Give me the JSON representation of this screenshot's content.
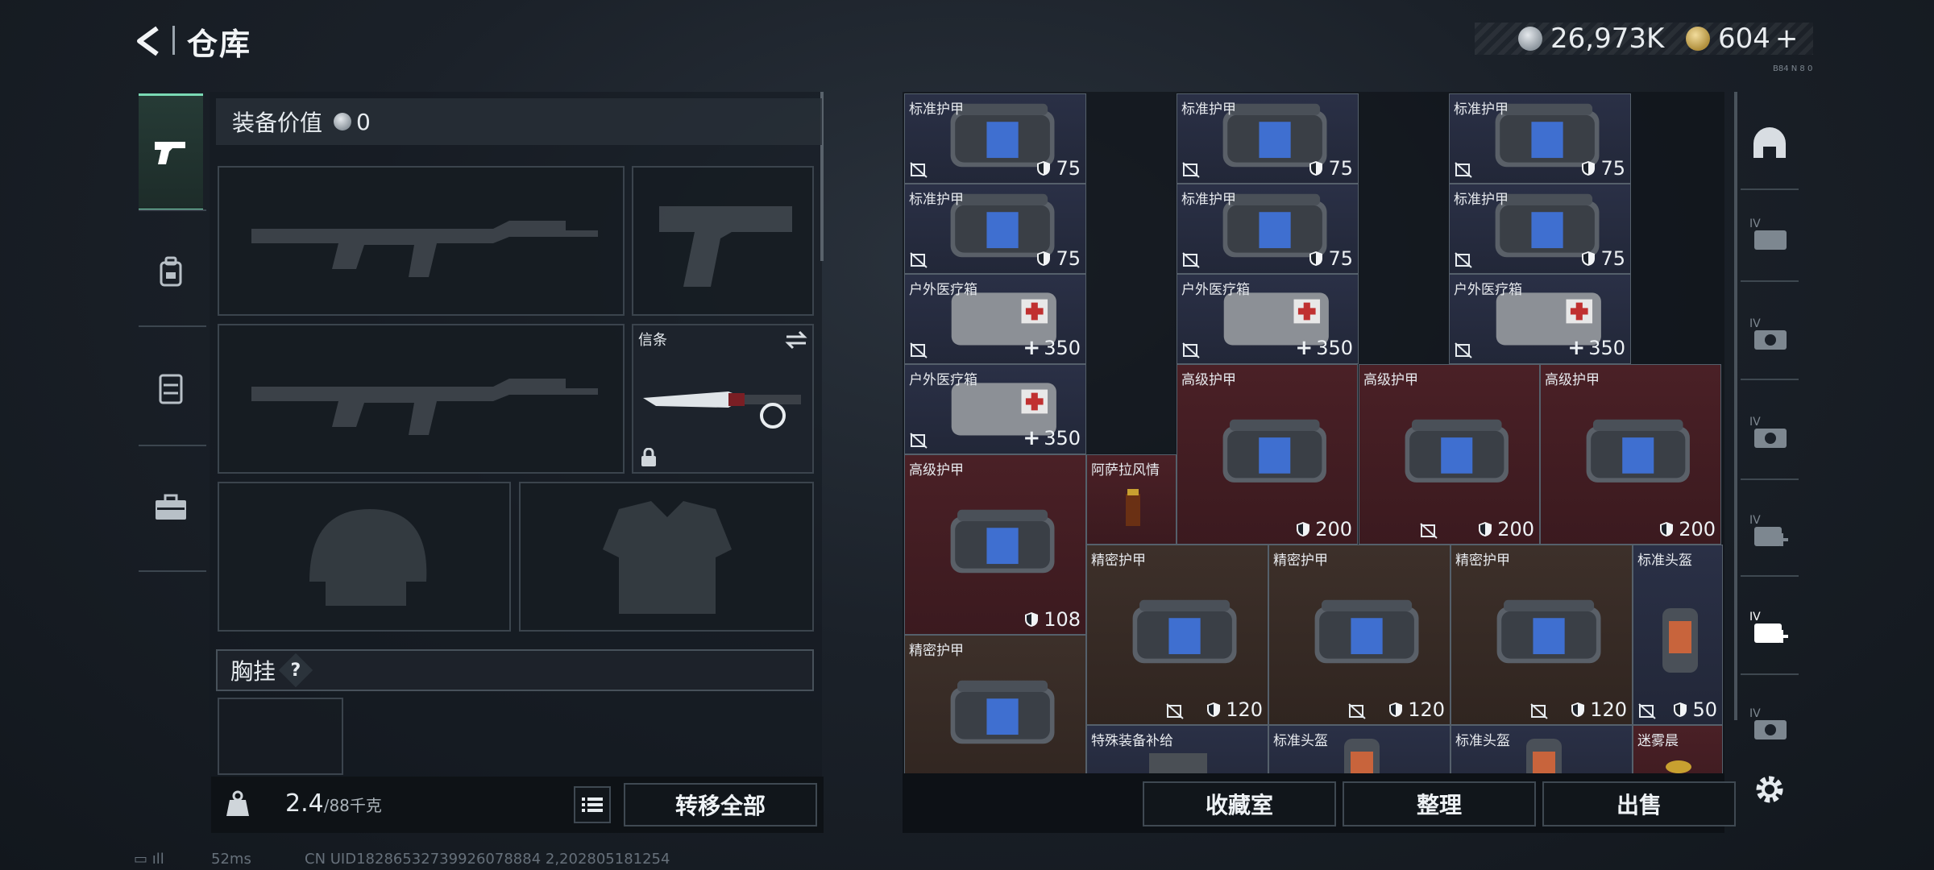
{
  "header": {
    "title": "仓库",
    "currency_silver": "26,973K",
    "currency_gold": "604",
    "plus": "+",
    "tiny_note": "B84 N 8 0"
  },
  "left_tabs": [
    "weapons",
    "backpack",
    "vest",
    "toolbox"
  ],
  "equipment": {
    "value_label": "装备价值",
    "value": "0",
    "knife_label": "信条",
    "chest_label": "胸挂",
    "chest_help": "?",
    "weight_current": "2.4",
    "weight_max": "/88千克",
    "transfer_all": "转移全部"
  },
  "grid": {
    "items": [
      {
        "name": "标准护甲",
        "value": "75",
        "type": "armor-std"
      },
      {
        "name": "标准护甲",
        "value": "75",
        "type": "armor-std"
      },
      {
        "name": "标准护甲",
        "value": "75",
        "type": "armor-std"
      },
      {
        "name": "标准护甲",
        "value": "75",
        "type": "armor-std"
      },
      {
        "name": "标准护甲",
        "value": "75",
        "type": "armor-std"
      },
      {
        "name": "标准护甲",
        "value": "75",
        "type": "armor-std"
      },
      {
        "name": "户外医疗箱",
        "value": "350",
        "type": "medkit"
      },
      {
        "name": "户外医疗箱",
        "value": "350",
        "type": "medkit"
      },
      {
        "name": "户外医疗箱",
        "value": "350",
        "type": "medkit"
      },
      {
        "name": "户外医疗箱",
        "value": "350",
        "type": "medkit"
      },
      {
        "name": "高级护甲",
        "value": "200",
        "type": "armor-adv"
      },
      {
        "name": "高级护甲",
        "value": "200",
        "type": "armor-adv"
      },
      {
        "name": "高级护甲",
        "value": "200",
        "type": "armor-adv"
      },
      {
        "name": "高级护甲",
        "value": "108",
        "type": "armor-adv"
      },
      {
        "name": "阿萨拉风情",
        "value": "",
        "type": "drink"
      },
      {
        "name": "精密护甲",
        "value": "120",
        "type": "armor-pre"
      },
      {
        "name": "精密护甲",
        "value": "120",
        "type": "armor-pre"
      },
      {
        "name": "精密护甲",
        "value": "120",
        "type": "armor-pre"
      },
      {
        "name": "标准头盔",
        "value": "50",
        "type": "helmet"
      },
      {
        "name": "精密护甲",
        "value": "",
        "type": "armor-pre"
      },
      {
        "name": "特殊装备补给",
        "value": "",
        "type": "supply"
      },
      {
        "name": "标准头盔",
        "value": "",
        "type": "helmet"
      },
      {
        "name": "标准头盔",
        "value": "",
        "type": "helmet"
      },
      {
        "name": "迷雾晨",
        "value": "",
        "type": "misc"
      }
    ]
  },
  "bottom_buttons": {
    "collection": "收藏室",
    "sort": "整理",
    "sell": "出售"
  },
  "right_tabs": [
    "helmet",
    "IV",
    "IV",
    "IV",
    "IV",
    "IV",
    "IV",
    "settings"
  ],
  "status": {
    "ping": "52ms",
    "uid": "CN UID18286532739926078884 2,202805181254"
  }
}
